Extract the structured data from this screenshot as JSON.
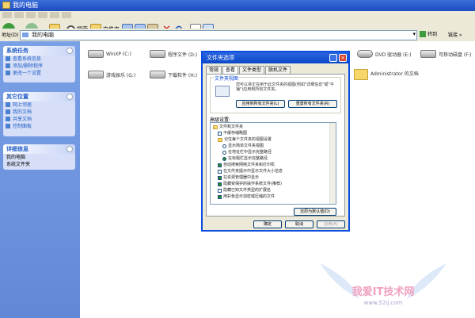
{
  "window": {
    "title": "我的电脑"
  },
  "toolbar": {
    "search_label": "搜索",
    "folders_label": "文件夹"
  },
  "address": {
    "label": "地址(D)",
    "value": "我的电脑",
    "go_label": "转到",
    "links_label": "链接"
  },
  "sidebar": {
    "panels": [
      {
        "title": "系统任务",
        "items": [
          "查看系统信息",
          "添加/删除程序",
          "更改一个设置"
        ]
      },
      {
        "title": "其它位置",
        "items": [
          "网上邻居",
          "我的文档",
          "共享文档",
          "控制面板"
        ]
      },
      {
        "title": "详细信息",
        "items": [
          "我的电脑",
          "系统文件夹"
        ]
      }
    ]
  },
  "drives": [
    {
      "label": "WinXP (C:)",
      "type": "drive"
    },
    {
      "label": "程序文件 (D:)",
      "type": "drive"
    },
    {
      "label": "DVD 驱动器 (E:)",
      "type": "cd"
    },
    {
      "label": "可移动磁盘 (F:)",
      "type": "drive"
    },
    {
      "label": "游戏娱乐 (G:)",
      "type": "drive"
    },
    {
      "label": "下载软件 (H:)",
      "type": "drive"
    },
    {
      "label": "Administrator 的文档",
      "type": "folder"
    }
  ],
  "dialog": {
    "title": "文件夹选项",
    "tabs": [
      "常规",
      "查看",
      "文件类型",
      "脱机文件"
    ],
    "active_tab": 1,
    "group_label": "文件夹视图",
    "group_text": "您可以将正在用于此文件夹的视图(例如\"详细信息\"或\"平铺\")应用到所有文件夹。",
    "apply_all_label": "应用到所有文件夹(L)",
    "reset_all_label": "重置所有文件夹(R)",
    "advanced_label": "高级设置:",
    "tree": [
      {
        "kind": "folder",
        "text": "文件和文件夹",
        "indent": 0
      },
      {
        "kind": "check",
        "on": false,
        "text": "不缓存缩略图",
        "indent": 1
      },
      {
        "kind": "folder",
        "text": "记住每个文件夹的视图设置",
        "indent": 1
      },
      {
        "kind": "radio",
        "on": false,
        "text": "显示简单文件夹视图",
        "indent": 2
      },
      {
        "kind": "radio",
        "on": false,
        "text": "在地址栏中显示完整路径",
        "indent": 2
      },
      {
        "kind": "radio",
        "on": true,
        "text": "在标题栏显示完整路径",
        "indent": 2
      },
      {
        "kind": "check",
        "on": true,
        "text": "自动搜索网络文件夹和打印机",
        "indent": 1
      },
      {
        "kind": "check",
        "on": false,
        "text": "在文件夹提示中显示文件大小信息",
        "indent": 1
      },
      {
        "kind": "check",
        "on": true,
        "text": "在资源管理器中显示",
        "indent": 1
      },
      {
        "kind": "check",
        "on": true,
        "text": "隐藏受保护的操作系统文件(推荐)",
        "indent": 1
      },
      {
        "kind": "check",
        "on": false,
        "text": "隐藏已知文件类型的扩展名",
        "indent": 1
      },
      {
        "kind": "check",
        "on": true,
        "text": "用彩色显示加密或压缩的文件",
        "indent": 1
      }
    ],
    "restore_label": "还原为默认值(D)",
    "ok_label": "确定",
    "cancel_label": "取消",
    "apply_label": "应用(A)"
  },
  "watermark": {
    "line1": "我爱IT技术网",
    "line2": "www.52ij.com"
  },
  "colors": {
    "titlebar": "#1c4cc0",
    "sidebar": "#6388d8",
    "dialog_border": "#0a4de0"
  }
}
